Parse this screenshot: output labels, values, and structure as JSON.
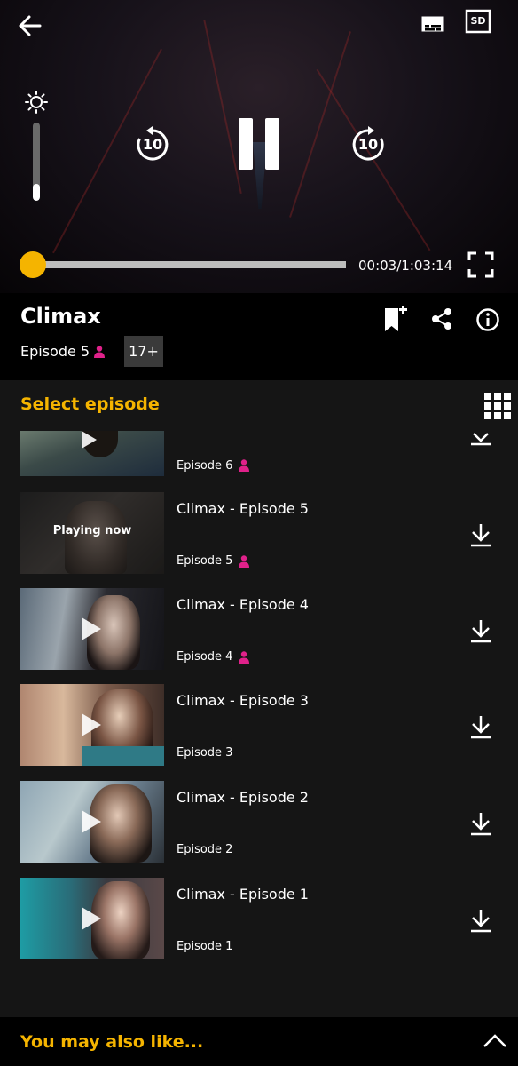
{
  "player": {
    "progress_fraction": 0.0008,
    "brightness_fraction": 0.22,
    "time_display": "00:03/1:03:14",
    "skip_back_seconds": "10",
    "skip_forward_seconds": "10",
    "quality_label": "SD"
  },
  "show": {
    "title": "Climax",
    "current_episode": "Episode 5",
    "age_rating": "17+"
  },
  "episodes": {
    "section_title": "Select episode",
    "items": [
      {
        "title": "",
        "sub": "Episode 6",
        "paid": true,
        "playing": false
      },
      {
        "title": "Climax - Episode 5",
        "sub": "Episode 5",
        "paid": true,
        "playing": true,
        "playing_label": "Playing now"
      },
      {
        "title": "Climax - Episode 4",
        "sub": "Episode 4",
        "paid": true,
        "playing": false
      },
      {
        "title": "Climax - Episode 3",
        "sub": "Episode 3",
        "paid": false,
        "playing": false
      },
      {
        "title": "Climax - Episode 2",
        "sub": "Episode 2",
        "paid": false,
        "playing": false
      },
      {
        "title": "Climax - Episode 1",
        "sub": "Episode 1",
        "paid": false,
        "playing": false
      }
    ]
  },
  "recommend": {
    "title": "You may also like..."
  },
  "colors": {
    "accent": "#f5b400",
    "paid_icon": "#e0218a",
    "panel": "#151515"
  }
}
